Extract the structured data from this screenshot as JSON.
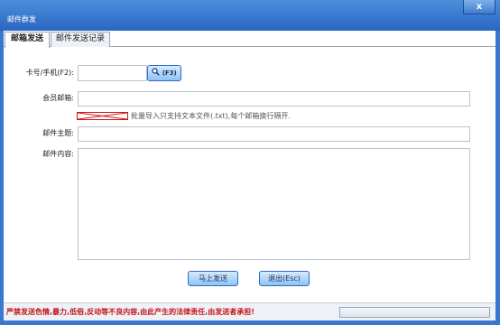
{
  "window": {
    "title": "邮件群发",
    "close_glyph": "x"
  },
  "tabs": [
    {
      "label": "邮箱发送",
      "active": true
    },
    {
      "label": "邮件发送记录",
      "active": false
    }
  ],
  "form": {
    "card_label": "卡号/手机(F2):",
    "card_value": "",
    "lookup_button": "(F3)",
    "member_email_label": "会员邮箱:",
    "member_email_value": "",
    "import_hint": "批量导入只支持文本文件(.txt),每个邮箱换行隔开.",
    "subject_label": "邮件主题:",
    "subject_value": "",
    "content_label": "邮件内容:",
    "content_value": ""
  },
  "buttons": {
    "send_now": "马上发送",
    "exit": "退出(Esc)"
  },
  "status": {
    "warning": "严禁发送色情,暴力,低俗,反动等不良内容,由此产生的法律责任,由发送者承担!",
    "progress": 0
  },
  "colors": {
    "titlebar": "#2a66c4",
    "button_bg": "#8ec3f5",
    "warning_text": "#c41414"
  },
  "icons": {
    "lookup": "magnifier-icon",
    "import": "broken-image-icon"
  }
}
